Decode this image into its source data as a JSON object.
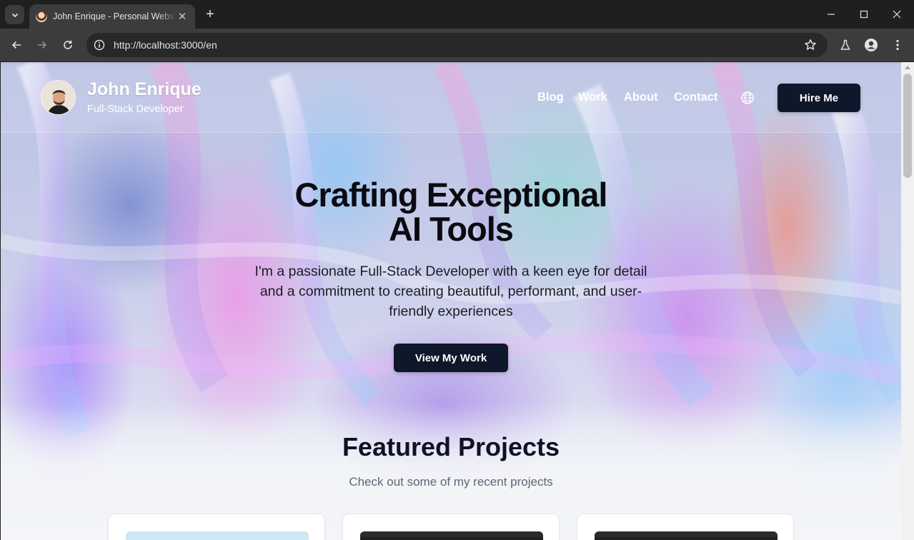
{
  "browser": {
    "tab_title": "John Enrique - Personal Website",
    "url": "http://localhost:3000/en",
    "icons": {
      "tab_menu": "chevron-down-icon",
      "close": "close-icon",
      "new_tab": "plus-icon",
      "back": "arrow-left-icon",
      "forward": "arrow-right-icon",
      "reload": "reload-icon",
      "site_info": "info-icon",
      "bookmark": "star-icon",
      "labs": "flask-icon",
      "profile": "profile-icon",
      "menu": "kebab-menu-icon"
    },
    "new_tab_glyph": "+",
    "close_glyph": "✕"
  },
  "header": {
    "name": "John Enrique",
    "role": "Full-Stack Developer",
    "nav": [
      "Blog",
      "Work",
      "About",
      "Contact"
    ],
    "language_icon": "globe-icon",
    "hire_label": "Hire Me"
  },
  "hero": {
    "title_line1": "Crafting Exceptional",
    "title_line2": "AI Tools",
    "description": "I'm a passionate Full-Stack Developer with a keen eye for detail and a commitment to creating beautiful, performant, and user-friendly experiences",
    "cta_label": "View My Work"
  },
  "projects": {
    "title": "Featured Projects",
    "subtitle": "Check out some of my recent projects"
  },
  "colors": {
    "primary_dark": "#0f172a",
    "chrome_bg": "#1f1f1f",
    "toolbar_bg": "#3c3c3c"
  }
}
